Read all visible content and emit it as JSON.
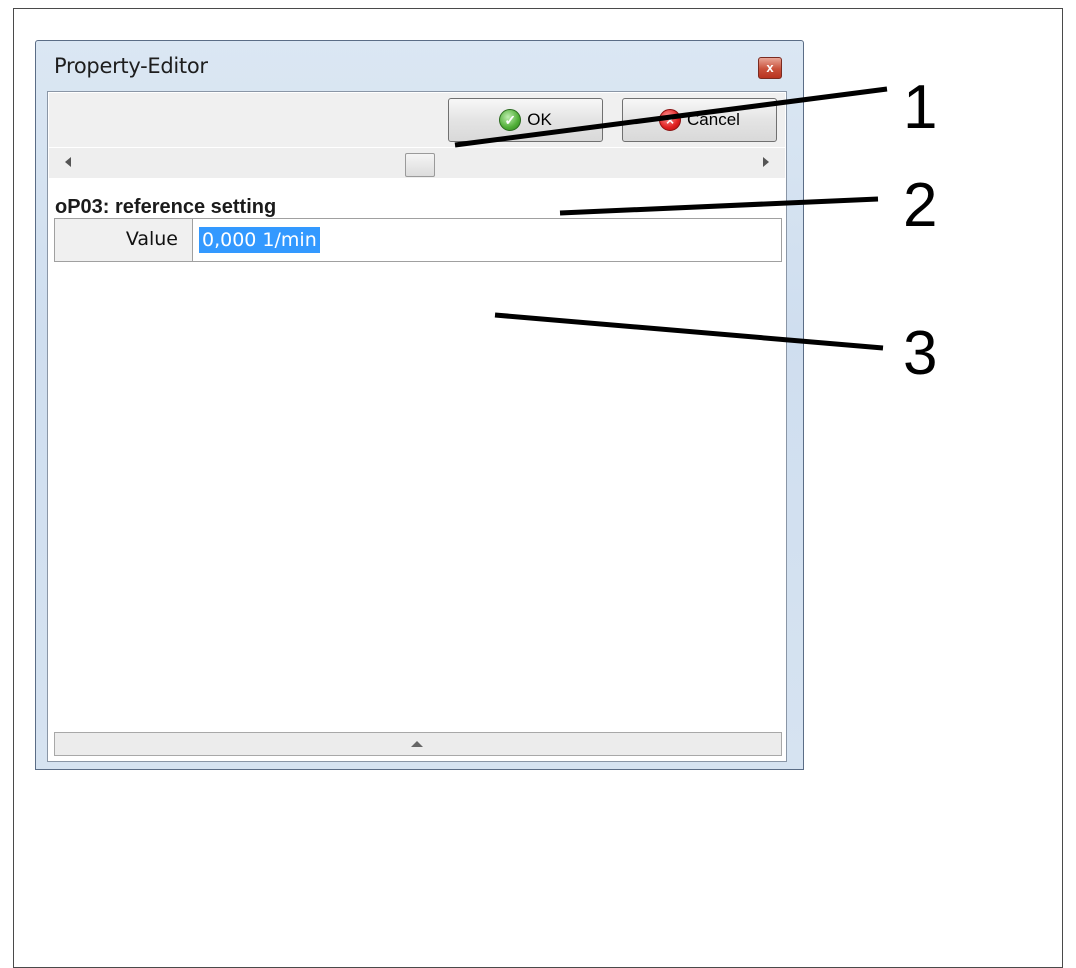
{
  "window": {
    "title": "Property-Editor",
    "close_label": "x"
  },
  "toolbar": {
    "ok_label": "OK",
    "cancel_label": "Cancel"
  },
  "parameter": {
    "heading": "oP03: reference setting",
    "row_label": "Value",
    "row_value": "0,000 1/min"
  },
  "callouts": [
    "1",
    "2",
    "3"
  ],
  "icons": {
    "ok": "check-circle-icon",
    "cancel": "stop-octagon-icon",
    "scroll_left": "arrow-left-icon",
    "scroll_right": "arrow-right-icon",
    "splitter": "triangle-up-icon"
  },
  "colors": {
    "selection": "#3399ff",
    "close_button": "#c9503a"
  }
}
